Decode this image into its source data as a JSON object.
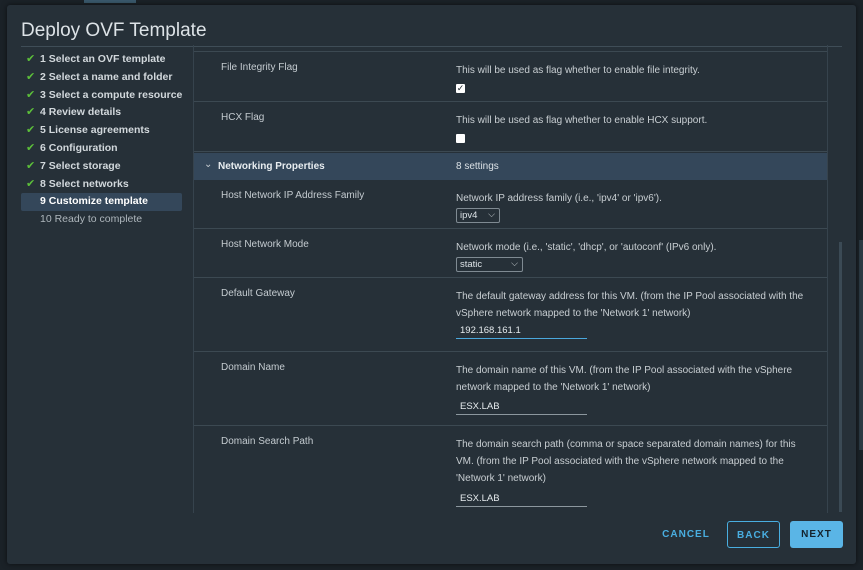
{
  "dialog": {
    "title": "Deploy OVF Template"
  },
  "steps": [
    {
      "label": "1 Select an OVF template",
      "state": "done"
    },
    {
      "label": "2 Select a name and folder",
      "state": "done"
    },
    {
      "label": "3 Select a compute resource",
      "state": "done"
    },
    {
      "label": "4 Review details",
      "state": "done"
    },
    {
      "label": "5 License agreements",
      "state": "done"
    },
    {
      "label": "6 Configuration",
      "state": "done"
    },
    {
      "label": "7 Select storage",
      "state": "done"
    },
    {
      "label": "8 Select networks",
      "state": "done"
    },
    {
      "label": "9 Customize template",
      "state": "current"
    },
    {
      "label": "10 Ready to complete",
      "state": "pending"
    }
  ],
  "properties": {
    "file_integrity": {
      "label": "File Integrity Flag",
      "description": "This will be used as flag whether to enable file integrity.",
      "checked": true
    },
    "hcx": {
      "label": "HCX Flag",
      "description": "This will be used as flag whether to enable HCX support.",
      "checked": false
    },
    "networking_section": {
      "name": "Networking Properties",
      "count": "8 settings",
      "expanded": true
    },
    "ip_family": {
      "label": "Host Network IP Address Family",
      "description": "Network IP address family (i.e., 'ipv4' or 'ipv6').",
      "value": "ipv4"
    },
    "network_mode": {
      "label": "Host Network Mode",
      "description": "Network mode (i.e., 'static', 'dhcp', or 'autoconf' (IPv6 only).",
      "value": "static"
    },
    "gateway": {
      "label": "Default Gateway",
      "description": "The default gateway address for this VM. (from the IP Pool associated with the vSphere network mapped to the 'Network 1' network)",
      "value": "192.168.161.1"
    },
    "domain_name": {
      "label": "Domain Name",
      "description": "The domain name of this VM. (from the IP Pool associated with the vSphere network mapped to the 'Network 1' network)",
      "value": "ESX.LAB"
    },
    "domain_search": {
      "label": "Domain Search Path",
      "description": "The domain search path (comma or space separated domain names) for this VM. (from the IP Pool associated with the vSphere network mapped to the 'Network 1' network)",
      "value": "ESX.LAB"
    }
  },
  "icons": {
    "check": "check-icon",
    "caret": "chevron-down-icon",
    "select_chevron": "chevron-down-icon"
  },
  "colors": {
    "accent": "#49aee0",
    "primary_button": "#5ab5e6",
    "check": "#5cbf3a",
    "section_bg": "#34475a"
  },
  "footer": {
    "cancel_label": "CANCEL",
    "back_label": "BACK",
    "next_label": "NEXT"
  }
}
